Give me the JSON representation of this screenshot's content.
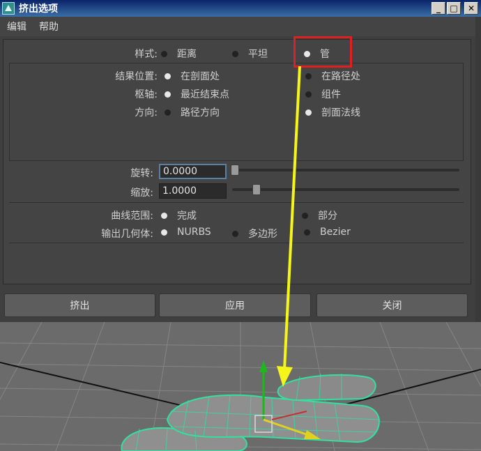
{
  "window": {
    "title": "挤出选项"
  },
  "menu": {
    "items": [
      "编辑",
      "帮助"
    ]
  },
  "style": {
    "label": "样式:",
    "options": [
      "距离",
      "平坦",
      "管"
    ],
    "selected": "管"
  },
  "result_position": {
    "label": "结果位置:",
    "options": [
      "在剖面处",
      "在路径处"
    ],
    "selected": "在剖面处"
  },
  "pivot": {
    "label": "枢轴:",
    "options": [
      "最近结束点",
      "组件"
    ],
    "selected": "最近结束点"
  },
  "direction": {
    "label": "方向:",
    "options": [
      "路径方向",
      "剖面法线"
    ],
    "selected": "剖面法线"
  },
  "rotation": {
    "label": "旋转:",
    "value": "0.0000",
    "slider_fraction": 0.0
  },
  "scale": {
    "label": "缩放:",
    "value": "1.0000",
    "slider_fraction": 0.1
  },
  "curve_range": {
    "label": "曲线范围:",
    "options": [
      "完成",
      "部分"
    ],
    "selected": "完成"
  },
  "output_geometry": {
    "label": "输出几何体:",
    "options": [
      "NURBS",
      "多边形",
      "Bezier"
    ],
    "selected": "NURBS"
  },
  "buttons": {
    "extrude": "挤出",
    "apply": "应用",
    "close": "关闭"
  },
  "annotation": {
    "highlight_color": "#e01f1f",
    "arrow_color": "#f5f51a"
  },
  "scene": {
    "mesh_color": "#33e0a0",
    "grid_color": "#8a8a8a"
  }
}
